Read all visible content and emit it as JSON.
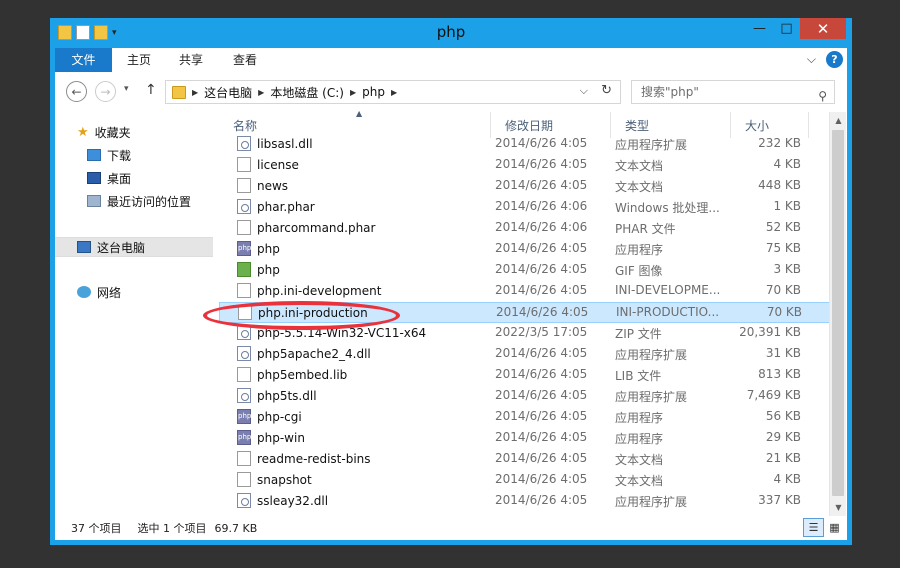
{
  "window": {
    "title": "php",
    "controls": {
      "minimize": "—",
      "maximize": "□",
      "close": "✕"
    }
  },
  "ribbon": {
    "tabs": [
      "文件",
      "主页",
      "共享",
      "查看"
    ],
    "expand": "⌵",
    "help": "?"
  },
  "address": {
    "back": "←",
    "forward": "→",
    "recent": "▾",
    "up": "↑",
    "breadcrumbs": [
      "这台电脑",
      "本地磁盘 (C:)",
      "php"
    ],
    "dropdown": "⌵",
    "refresh": "↻",
    "search_placeholder": "搜索\"php\""
  },
  "nav": {
    "items": [
      {
        "label": "收藏夹",
        "icon": "star-icon"
      },
      {
        "label": "下载",
        "icon": "download-folder-icon"
      },
      {
        "label": "桌面",
        "icon": "desktop-icon"
      },
      {
        "label": "最近访问的位置",
        "icon": "recent-places-icon"
      },
      {
        "label": "这台电脑",
        "icon": "computer-icon"
      },
      {
        "label": "网络",
        "icon": "network-icon"
      }
    ]
  },
  "columns": {
    "name": "名称",
    "date": "修改日期",
    "type": "类型",
    "size": "大小"
  },
  "files": [
    {
      "name": "libsasl.dll",
      "date": "2014/6/26 4:05",
      "type": "应用程序扩展",
      "size": "232 KB",
      "icon": "dll-icon"
    },
    {
      "name": "license",
      "date": "2014/6/26 4:05",
      "type": "文本文档",
      "size": "4 KB",
      "icon": "text-file-icon"
    },
    {
      "name": "news",
      "date": "2014/6/26 4:05",
      "type": "文本文档",
      "size": "448 KB",
      "icon": "text-file-icon"
    },
    {
      "name": "phar.phar",
      "date": "2014/6/26 4:06",
      "type": "Windows 批处理...",
      "size": "1 KB",
      "icon": "batch-file-icon"
    },
    {
      "name": "pharcommand.phar",
      "date": "2014/6/26 4:06",
      "type": "PHAR 文件",
      "size": "52 KB",
      "icon": "blank-file-icon"
    },
    {
      "name": "php",
      "date": "2014/6/26 4:05",
      "type": "应用程序",
      "size": "75 KB",
      "icon": "php-exe-icon"
    },
    {
      "name": "php",
      "date": "2014/6/26 4:05",
      "type": "GIF 图像",
      "size": "3 KB",
      "icon": "gif-image-icon"
    },
    {
      "name": "php.ini-development",
      "date": "2014/6/26 4:05",
      "type": "INI-DEVELOPME...",
      "size": "70 KB",
      "icon": "blank-file-icon"
    },
    {
      "name": "php.ini-production",
      "date": "2014/6/26 4:05",
      "type": "INI-PRODUCTIO...",
      "size": "70 KB",
      "icon": "blank-file-icon",
      "selected": true
    },
    {
      "name": "php-5.5.14-Win32-VC11-x64",
      "date": "2022/3/5 17:05",
      "type": "ZIP 文件",
      "size": "20,391 KB",
      "icon": "zip-file-icon"
    },
    {
      "name": "php5apache2_4.dll",
      "date": "2014/6/26 4:05",
      "type": "应用程序扩展",
      "size": "31 KB",
      "icon": "dll-icon"
    },
    {
      "name": "php5embed.lib",
      "date": "2014/6/26 4:05",
      "type": "LIB 文件",
      "size": "813 KB",
      "icon": "blank-file-icon"
    },
    {
      "name": "php5ts.dll",
      "date": "2014/6/26 4:05",
      "type": "应用程序扩展",
      "size": "7,469 KB",
      "icon": "dll-icon"
    },
    {
      "name": "php-cgi",
      "date": "2014/6/26 4:05",
      "type": "应用程序",
      "size": "56 KB",
      "icon": "php-exe-icon"
    },
    {
      "name": "php-win",
      "date": "2014/6/26 4:05",
      "type": "应用程序",
      "size": "29 KB",
      "icon": "php-exe-icon"
    },
    {
      "name": "readme-redist-bins",
      "date": "2014/6/26 4:05",
      "type": "文本文档",
      "size": "21 KB",
      "icon": "text-file-icon"
    },
    {
      "name": "snapshot",
      "date": "2014/6/26 4:05",
      "type": "文本文档",
      "size": "4 KB",
      "icon": "text-file-icon"
    },
    {
      "name": "ssleay32.dll",
      "date": "2014/6/26 4:05",
      "type": "应用程序扩展",
      "size": "337 KB",
      "icon": "dll-icon"
    }
  ],
  "status": {
    "count": "37 个项目",
    "selection": "选中 1 个项目",
    "size": "69.7 KB"
  },
  "colors": {
    "accent": "#1ca0e8",
    "file_tab": "#1979ca",
    "selection": "#cce8ff",
    "annotation": "#e8323c"
  }
}
